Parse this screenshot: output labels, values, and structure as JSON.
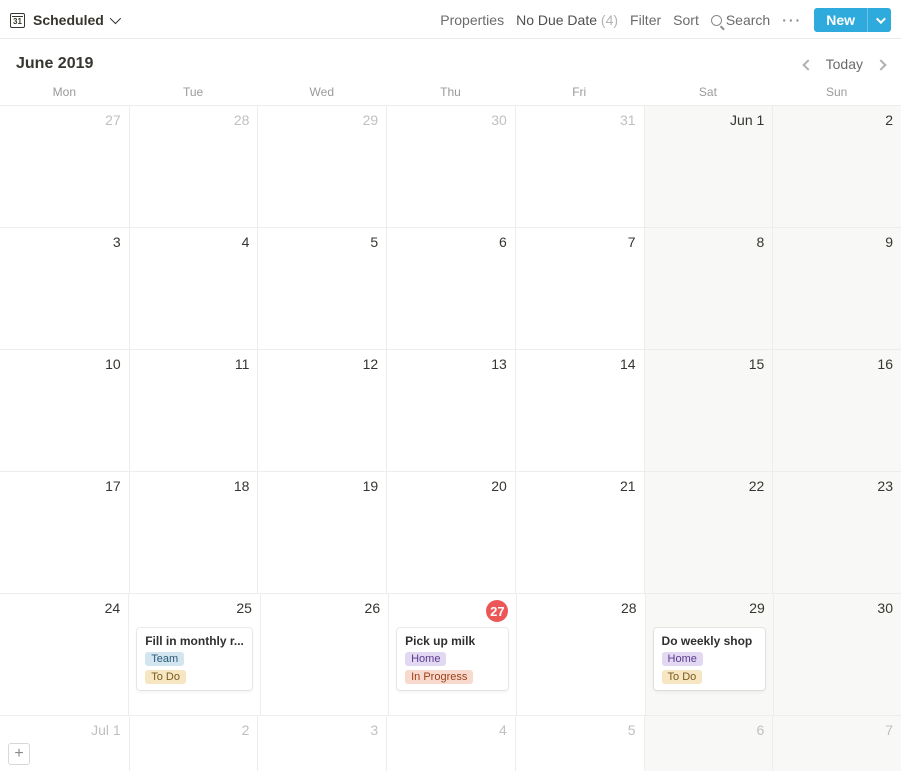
{
  "toolbar": {
    "view_title": "Scheduled",
    "properties_label": "Properties",
    "no_due_date_label": "No Due Date",
    "no_due_date_count": "(4)",
    "filter_label": "Filter",
    "sort_label": "Sort",
    "search_label": "Search",
    "more_label": "···",
    "new_label": "New"
  },
  "month": {
    "title": "June 2019",
    "today_label": "Today"
  },
  "weekdays": [
    "Mon",
    "Tue",
    "Wed",
    "Thu",
    "Fri",
    "Sat",
    "Sun"
  ],
  "weeks": [
    [
      {
        "label": "27",
        "outside": true
      },
      {
        "label": "28",
        "outside": true
      },
      {
        "label": "29",
        "outside": true
      },
      {
        "label": "30",
        "outside": true
      },
      {
        "label": "31",
        "outside": true
      },
      {
        "label": "Jun 1",
        "weekend": true
      },
      {
        "label": "2",
        "weekend": true
      }
    ],
    [
      {
        "label": "3"
      },
      {
        "label": "4"
      },
      {
        "label": "5"
      },
      {
        "label": "6"
      },
      {
        "label": "7"
      },
      {
        "label": "8",
        "weekend": true
      },
      {
        "label": "9",
        "weekend": true
      }
    ],
    [
      {
        "label": "10"
      },
      {
        "label": "11"
      },
      {
        "label": "12"
      },
      {
        "label": "13"
      },
      {
        "label": "14"
      },
      {
        "label": "15",
        "weekend": true
      },
      {
        "label": "16",
        "weekend": true
      }
    ],
    [
      {
        "label": "17"
      },
      {
        "label": "18"
      },
      {
        "label": "19"
      },
      {
        "label": "20"
      },
      {
        "label": "21"
      },
      {
        "label": "22",
        "weekend": true
      },
      {
        "label": "23",
        "weekend": true
      }
    ],
    [
      {
        "label": "24"
      },
      {
        "label": "25",
        "events": [
          {
            "title": "Fill in monthly r...",
            "tags": [
              {
                "text": "Team",
                "cls": "tag-blue"
              },
              {
                "text": "To Do",
                "cls": "tag-yellow"
              }
            ]
          }
        ]
      },
      {
        "label": "26"
      },
      {
        "label": "27",
        "today": true,
        "events": [
          {
            "title": "Pick up milk",
            "tags": [
              {
                "text": "Home",
                "cls": "tag-purple"
              },
              {
                "text": "In Progress",
                "cls": "tag-orange"
              }
            ]
          }
        ]
      },
      {
        "label": "28"
      },
      {
        "label": "29",
        "weekend": true,
        "events": [
          {
            "title": "Do weekly shop",
            "tags": [
              {
                "text": "Home",
                "cls": "tag-purple"
              },
              {
                "text": "To Do",
                "cls": "tag-yellow"
              }
            ]
          }
        ]
      },
      {
        "label": "30",
        "weekend": true
      }
    ],
    [
      {
        "label": "Jul 1",
        "outside": true
      },
      {
        "label": "2",
        "outside": true
      },
      {
        "label": "3",
        "outside": true
      },
      {
        "label": "4",
        "outside": true
      },
      {
        "label": "5",
        "outside": true
      },
      {
        "label": "6",
        "outside": true,
        "weekend": true
      },
      {
        "label": "7",
        "outside": true,
        "weekend": true
      }
    ]
  ],
  "cal_icon_text": "31"
}
